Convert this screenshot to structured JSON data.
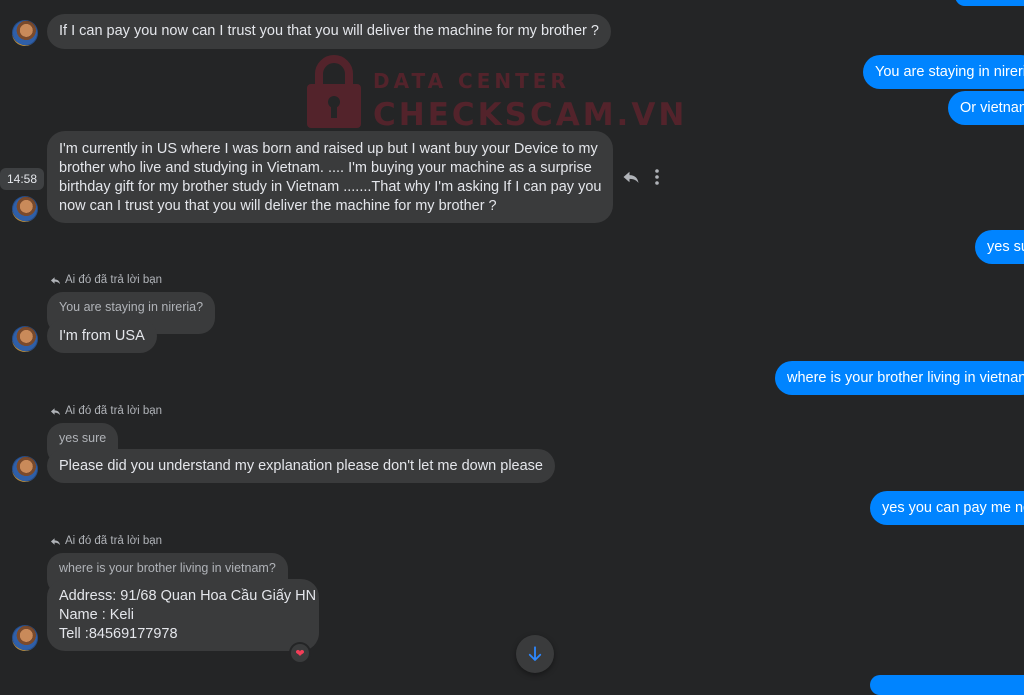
{
  "watermark": {
    "line1": "DATA CENTER",
    "line2": "CHECKSCAM.VN"
  },
  "hover_time": "14:58",
  "reply_label": "Ai đó đã trả lời bạn",
  "incoming": {
    "msg1": "If I can pay you now can I trust you that you will deliver the machine for my brother ?",
    "msg2_lines": [
      "I'm currently in US where I was born and raised up but I want buy your Device to my",
      "brother who live and studying in Vietnam. .... I'm buying your machine as a surprise",
      "birthday gift for my brother study in Vietnam .......That why I'm asking If I can pay you",
      "now can I trust you that you will deliver the machine for my brother ?"
    ],
    "quote1": "You are staying in nireria?",
    "msg3": "I'm from USA",
    "quote2": "yes sure",
    "msg4": "Please did you understand my explanation please don't let me down please",
    "quote3": "where is your brother living in vietnam?",
    "msg5_lines": [
      "Address: 91/68 Quan Hoa Cầu Giấy HN",
      "Name :  Keli",
      "Tell   :84569177978"
    ],
    "reaction": "❤"
  },
  "outgoing": {
    "msg1": "You are staying in nireri",
    "msg2": "Or vietnan",
    "msg3": "yes su",
    "msg4": "where is your brother living in vietnan",
    "msg5": "yes you can pay me no"
  },
  "icons": {
    "reply": "reply-icon",
    "more": "more-vertical-icon",
    "scroll_down": "arrow-down-icon",
    "lock": "lock-icon"
  },
  "colors": {
    "background": "#242526",
    "incoming_bubble": "#3a3b3c",
    "outgoing_bubble": "#0084ff",
    "watermark": "#7b2330"
  }
}
